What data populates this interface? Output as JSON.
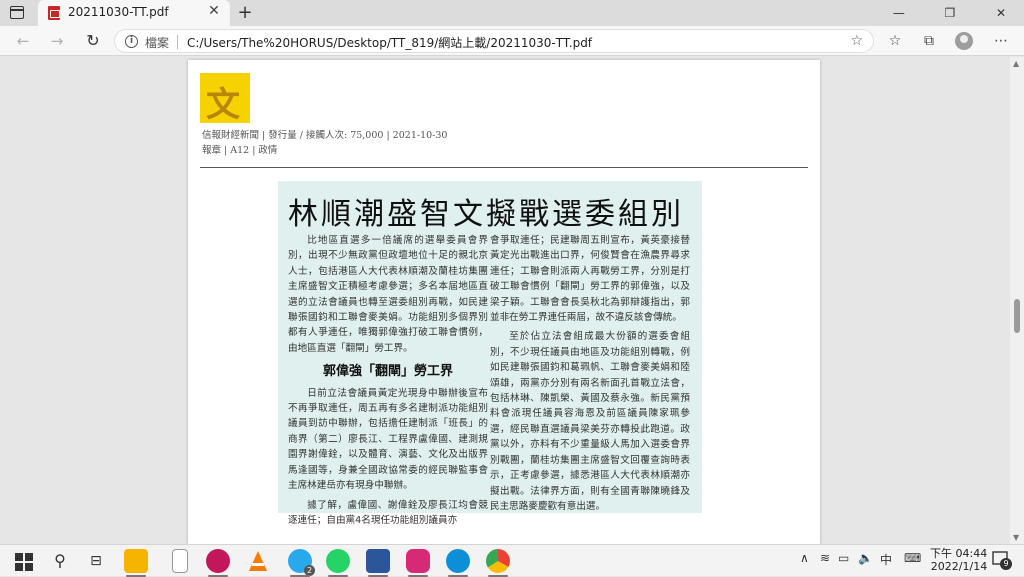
{
  "browser": {
    "tab_title": "20211030-TT.pdf",
    "tab_close": "✕",
    "new_tab": "+",
    "minimize": "—",
    "maximize": "❐",
    "close": "✕",
    "back": "←",
    "forward": "→",
    "reload": "↻",
    "info": "i",
    "file_label": "檔案",
    "url": "C:/Users/The%20HORUS/Desktop/TT_819/網站上載/20211030-TT.pdf"
  },
  "document": {
    "logo_char": "文",
    "meta_line1": "信報財經新聞 | 發行量 / 接觸人次: 75,000 | 2021-10-30",
    "meta_line2": "報章 | A12 | 政情",
    "headline": "林順潮盛智文擬戰選委組別",
    "left_p1": "比地區直選多一倍議席的選舉委員會界別，出現不少無政黨但政壇地位十足的親北京人士，包括港區人大代表林順潮及蘭桂坊集團主席盛智文正積極考慮參選；多名本屆地區直選的立法會議員也轉至選委組別再戰，如民建聯張國鈞和工聯會麥美娟。功能組別多個界別都有人爭連任，唯獨郭偉強打破工聯會慣例，由地區直選「翻閘」勞工界。",
    "subhead": "郭偉強「翻閘」勞工界",
    "left_p2": "日前立法會議員黃定光現身中聯辦後宣布不再爭取連任，周五再有多名建制派功能組別議員到訪中聯辦，包括擔任建制派「班長」的商界（第二）廖長江、工程界盧偉國、建測規園界謝偉銓，以及體育、演藝、文化及出版界馬逢國等，身兼全國政協常委的經民聯監事會主席林建岳亦有現身中聯辦。",
    "left_p3": "據了解，盧偉國、謝偉銓及廖長江均會競逐連任；自由黨4名現任功能組別議員亦",
    "right_p1": "會爭取連任；民建聯周五則宣布，黃英豪接替黃定光出戰進出口界，何俊賢會在漁農界尋求連任；工聯會則派兩人再戰勞工界，分別是打破工聯會慣例「翻閘」勞工界的郭偉強，以及梁子穎。工聯會會長吳秋北為郭辯護指出，郭並非在勞工界連任兩屆，故不違反該會傳統。",
    "right_p2": "至於佔立法會組成最大份額的選委會組別，不少現任議員由地區及功能組別轉戰，例如民建聯張國鈞和葛珮帆、工聯會麥美娟和陸頌雄，兩黨亦分別有兩名新面孔首戰立法會，包括林琳、陳凱榮、黃國及蔡永強。新民黨預料會派現任議員容海恩及前區議員陳家珮參選，經民聯直選議員梁美芬亦轉投此跑道。政黨以外，亦料有不少重量級人馬加入選委會界別戰團，蘭桂坊集團主席盛智文回覆查詢時表示，正考慮參選，據悉港區人大代表林順潮亦擬出戰。法律界方面，則有全國青聯陳曉鋒及民主思路麥慶歡有意出選。"
  },
  "taskbar": {
    "time": "下午 04:44",
    "date": "2022/1/14",
    "ime": "中",
    "notif_count": "9",
    "apps": [
      "file-explorer",
      "notepad",
      "snip",
      "vlc",
      "telegram",
      "whatsapp",
      "word",
      "instagram",
      "edge",
      "chrome"
    ],
    "telegram_badge": "2"
  }
}
